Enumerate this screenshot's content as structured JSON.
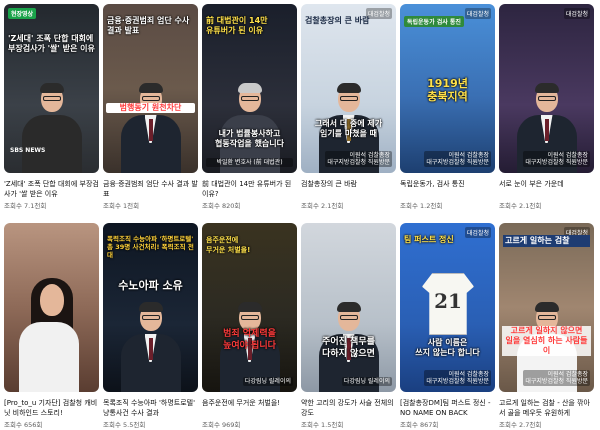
{
  "colors": {
    "title_text": "#0f0f0f",
    "meta_text": "#606060",
    "caption_red": "#ff3b3b",
    "caption_yellow": "#ffe14a"
  },
  "videos": [
    {
      "title": "'Z세대' 조폭 단합 대회에 부장검사가 '쌀 받은 이유",
      "views": "조회수 7.1천회",
      "thumb": {
        "badge": "현장영상",
        "headline": "'Z세대' 조폭 단합 대회에\n부장검사가 '쌀' 받은 이유",
        "caption": "",
        "channel": "SBS NEWS",
        "corner": ""
      }
    },
    {
      "title": "금융·증권범죄 엄단 수사 결과 발표",
      "views": "조회수 1천회",
      "thumb": {
        "badge": "",
        "headline": "금융·증권범죄 엄단 수사 결과 발표",
        "caption": "범행동기 원천차단",
        "channel": "",
        "corner": ""
      }
    },
    {
      "title": "前 대법관이 14만 유튜버가 된 이유?",
      "views": "조회수 820회",
      "thumb": {
        "badge": "",
        "headline": "前 대법관이 14만\n유튜버가 된 이유",
        "caption": "내가 법률봉사하고\n협동작업을 했습니다",
        "channel": "박일환 변호사 (前 대법관)",
        "corner": ""
      }
    },
    {
      "title": "검찰총장의 큰 바람",
      "views": "조회수 2.1천회",
      "thumb": {
        "badge": "",
        "headline": "검찰총장의 큰 바람",
        "caption": "그래서 더 중에 제가\n임기를 마쳤을 때",
        "channel": "이원석 검찰총장\n대구지방검찰청 직원방문",
        "corner": "대검찰청"
      }
    },
    {
      "title": "독립운동가, 검사 통진",
      "views": "조회수 1.2천회",
      "thumb": {
        "badge": "독립운동가 검사 통진",
        "headline": "",
        "caption": "1919년\n충북지역",
        "channel": "이원석 검찰총장\n대구지방검찰청 직원방문",
        "corner": "대검찰청"
      }
    },
    {
      "title": "서로 눈이 부은 가운데",
      "views": "조회수 2.1천회",
      "thumb": {
        "badge": "",
        "headline": "",
        "caption": "",
        "channel": "이원석 검찰총장\n대구지방검찰청 직원방문",
        "corner": "대검찰청"
      }
    },
    {
      "title": "[Pro_to_u 기자단] 검찰청 캐비닛 비하인드 스토리!",
      "views": "조회수 656회",
      "thumb": {
        "badge": "",
        "headline": "",
        "caption": "",
        "channel": "",
        "corner": ""
      }
    },
    {
      "title": "목록조직 수능아파 '하명트로텔' 냥통사건 수사 결과",
      "views": "조회수 5.5천회",
      "thumb": {
        "badge": "",
        "headline": "폭력조직 수능아파 '하명트로텔'\n총 39명 사건처리! 폭력조직 전대",
        "caption": "수노아파 소유",
        "channel": "",
        "corner": ""
      }
    },
    {
      "title": "음주운전에 무거운 처벌을!",
      "views": "조회수 969회",
      "thumb": {
        "badge": "",
        "headline": "음주운전에\n무거운 처벌을!",
        "caption": "범죄 억제력을\n높여야 됩니다",
        "channel": "다강림닝 릴레이의",
        "corner": ""
      }
    },
    {
      "title": "약한 고리의 강도가 사슬 전체의 강도",
      "views": "조회수 1.5천회",
      "thumb": {
        "badge": "",
        "headline": "",
        "caption": "주어진 책무를\n다하지 않으면",
        "channel": "다강림닝 릴레이의",
        "corner": ""
      }
    },
    {
      "title": "[검찰총장DM]팀 퍼스트 정신 - NO NAME ON BACK",
      "views": "조회수 867회",
      "thumb": {
        "badge": "",
        "headline": "팀 퍼스트 정신",
        "caption": "사람 이름은\n쓰지 않는다 합니다",
        "channel": "이원석 검찰총장\n대구지방검찰청 직원방문",
        "corner": "대검찰청"
      }
    },
    {
      "title": "고르게 일하는 검찰 - 산을 깎아서 골을 메우듯 유원하게",
      "views": "조회수 2.7천회",
      "thumb": {
        "badge": "",
        "headline": "고르게 일하는 검찰",
        "caption": "고르게 일하지 않으면\n일을 열심히 하는 사람들이",
        "channel": "이원석 검찰총장\n대구지방검찰청 직원방문",
        "corner": "대검찰청"
      }
    }
  ]
}
